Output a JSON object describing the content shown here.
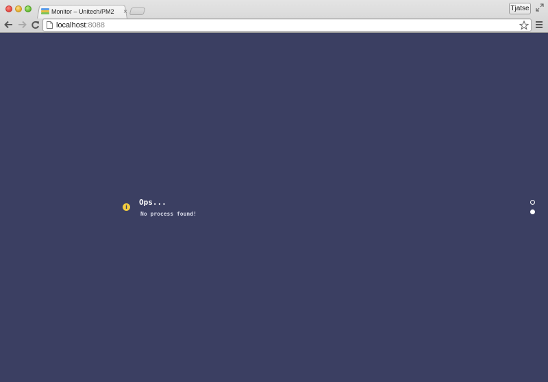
{
  "browser": {
    "tab": {
      "title": "Monitor – Unitech/PM2",
      "close_label": "×"
    },
    "profile_name": "Tjatse",
    "address_bar": {
      "host": "localhost",
      "port": ":8088"
    }
  },
  "page": {
    "notice": {
      "icon": "info-icon",
      "icon_glyph": "i",
      "title": "Ops...",
      "message": "No process found!"
    },
    "pager": {
      "dots": 2,
      "active_index": 1
    },
    "colors": {
      "background": "#3b3f62",
      "icon": "#f3cc3e",
      "text": "#ffffff"
    }
  }
}
